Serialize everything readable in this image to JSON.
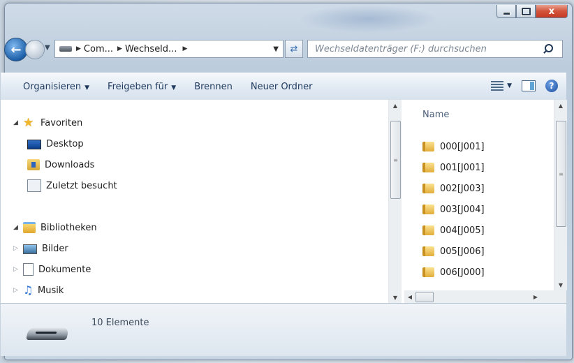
{
  "window": {
    "caption_buttons": {
      "minimize": "minimize",
      "maximize": "maximize",
      "close": "x"
    }
  },
  "navigation": {
    "breadcrumbs": [
      "Com...",
      "Wechseld..."
    ],
    "search_placeholder": "Wechseldatenträger (F:) durchsuchen"
  },
  "toolbar": {
    "organize": "Organisieren",
    "share": "Freigeben für",
    "burn": "Brennen",
    "new_folder": "Neuer Ordner"
  },
  "navpane": {
    "favorites": {
      "label": "Favoriten",
      "items": [
        "Desktop",
        "Downloads",
        "Zuletzt besucht"
      ]
    },
    "libraries": {
      "label": "Bibliotheken",
      "items": [
        "Bilder",
        "Dokumente",
        "Musik"
      ]
    }
  },
  "filepane": {
    "column_name": "Name",
    "files": [
      "000[J001]",
      "001[J001]",
      "002[J003]",
      "003[J004]",
      "004[J005]",
      "005[J006]",
      "006[J000]"
    ]
  },
  "details": {
    "item_count": "10 Elemente"
  },
  "icons": {
    "back": "back-arrow-icon",
    "forward": "forward-arrow-icon",
    "refresh": "refresh-icon",
    "search": "search-icon",
    "folder": "folder-icon",
    "drive": "usb-drive-icon"
  },
  "colors": {
    "accent": "#1e395b",
    "close_button": "#c63a24",
    "folder": "#e2ad3a"
  }
}
